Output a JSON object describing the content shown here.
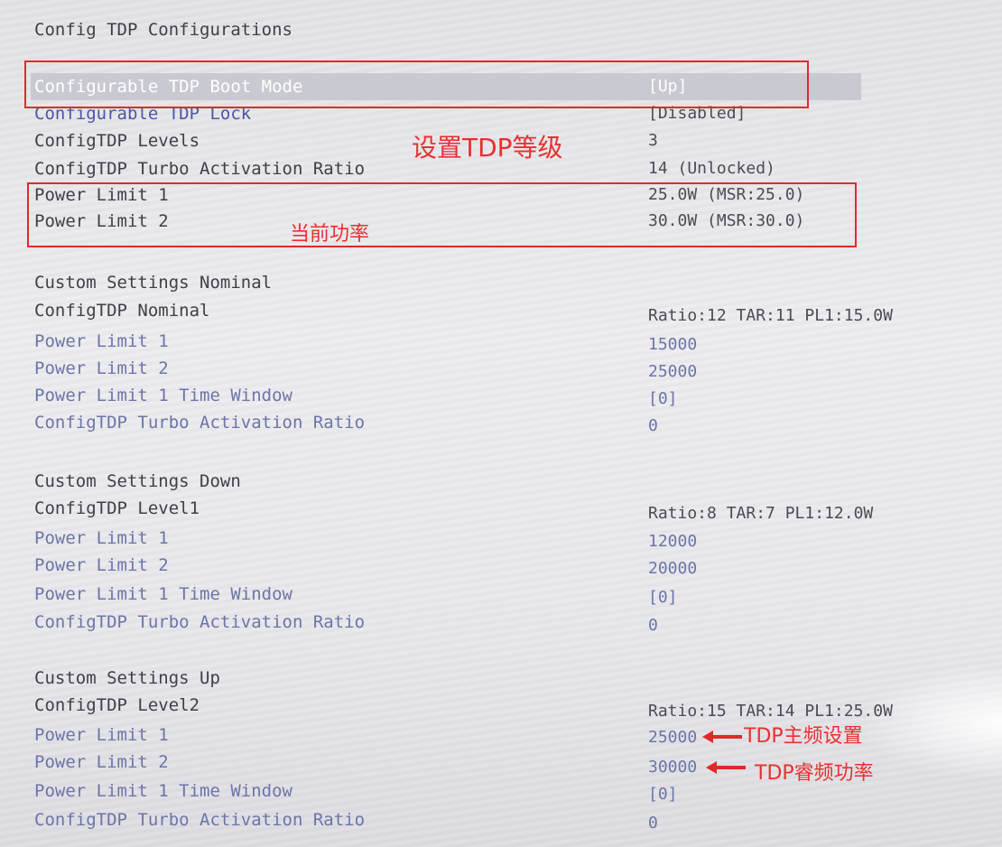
{
  "title": "Config TDP Configurations",
  "top_settings": [
    {
      "label": "Configurable TDP Boot Mode",
      "value": "[Up]"
    },
    {
      "label": "Configurable TDP Lock",
      "value": "[Disabled]"
    },
    {
      "label": "ConfigTDP Levels",
      "value": "3"
    },
    {
      "label": "ConfigTDP Turbo Activation Ratio",
      "value": "14 (Unlocked)"
    },
    {
      "label": "Power Limit 1",
      "value": "25.0W (MSR:25.0)"
    },
    {
      "label": "Power Limit 2",
      "value": "30.0W (MSR:30.0)"
    }
  ],
  "sections": [
    {
      "heading": "Custom Settings Nominal",
      "summary": {
        "label": "ConfigTDP Nominal",
        "value": "Ratio:12 TAR:11 PL1:15.0W"
      },
      "rows": [
        {
          "label": "Power Limit 1",
          "value": "15000"
        },
        {
          "label": "Power Limit 2",
          "value": "25000"
        },
        {
          "label": "Power Limit 1 Time Window",
          "value": "[0]"
        },
        {
          "label": "ConfigTDP Turbo Activation Ratio",
          "value": "0"
        }
      ]
    },
    {
      "heading": "Custom Settings Down",
      "summary": {
        "label": "ConfigTDP Level1",
        "value": "Ratio:8 TAR:7 PL1:12.0W"
      },
      "rows": [
        {
          "label": "Power Limit 1",
          "value": "12000"
        },
        {
          "label": "Power Limit 2",
          "value": "20000"
        },
        {
          "label": "Power Limit 1 Time Window",
          "value": "[0]"
        },
        {
          "label": "ConfigTDP Turbo Activation Ratio",
          "value": "0"
        }
      ]
    },
    {
      "heading": "Custom Settings Up",
      "summary": {
        "label": "ConfigTDP Level2",
        "value": "Ratio:15 TAR:14 PL1:25.0W"
      },
      "rows": [
        {
          "label": "Power Limit 1",
          "value": "25000"
        },
        {
          "label": "Power Limit 2",
          "value": "30000"
        },
        {
          "label": "Power Limit 1 Time Window",
          "value": "[0]"
        },
        {
          "label": "ConfigTDP Turbo Activation Ratio",
          "value": "0"
        }
      ]
    }
  ],
  "annotations": {
    "tdp_level": "设置TDP等级",
    "current_power": "当前功率",
    "tdp_base_freq": "TDP主频设置",
    "tdp_turbo_power": "TDP睿频功率"
  },
  "colors": {
    "annotation": "#e02a2a",
    "text_gray": "#3f3f47",
    "text_blue": "#6c75a8"
  }
}
